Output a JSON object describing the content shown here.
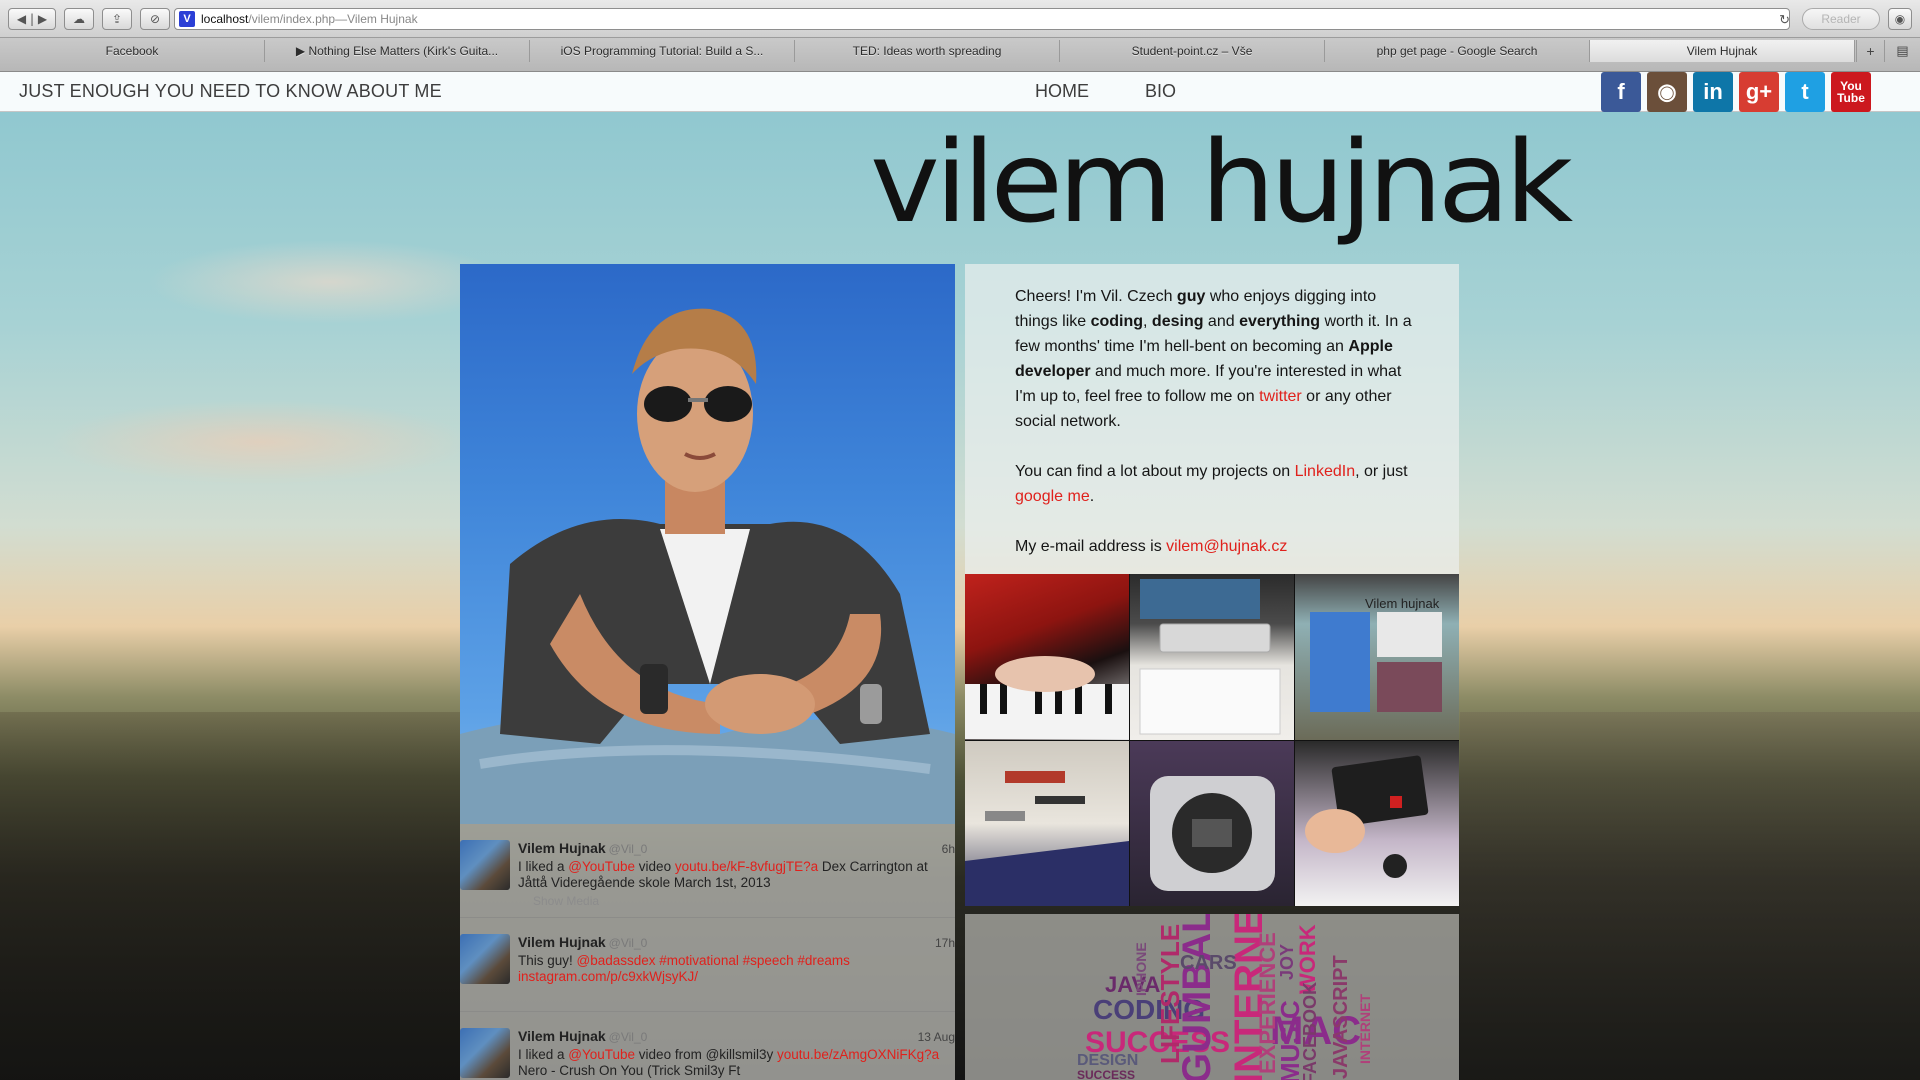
{
  "browser": {
    "url_host": "localhost",
    "url_path": "/vilem/index.php",
    "url_separator": " — ",
    "page_title": "Vilem Hujnak",
    "reader_label": "Reader",
    "tabs": [
      {
        "label": "Facebook",
        "active": false
      },
      {
        "label": "▶ Nothing Else Matters (Kirk's Guita...",
        "active": false
      },
      {
        "label": "iOS Programming Tutorial: Build a S...",
        "active": false
      },
      {
        "label": "TED: Ideas worth spreading",
        "active": false
      },
      {
        "label": "Student-point.cz – Vše",
        "active": false
      },
      {
        "label": "php get page - Google Search",
        "active": false
      },
      {
        "label": "Vilem Hujnak",
        "active": true
      }
    ]
  },
  "header": {
    "tagline": "JUST ENOUGH YOU NEED TO KNOW ABOUT ME",
    "nav": [
      {
        "label": "HOME"
      },
      {
        "label": "BIO"
      }
    ],
    "socials": [
      {
        "name": "facebook",
        "glyph": "f",
        "color": "#3b5998"
      },
      {
        "name": "instagram",
        "glyph": "◉",
        "color": "#6b4f3a"
      },
      {
        "name": "linkedin",
        "glyph": "in",
        "color": "#0e76a8"
      },
      {
        "name": "googleplus",
        "glyph": "g+",
        "color": "#d73d32"
      },
      {
        "name": "twitter",
        "glyph": "t",
        "color": "#1fa0e3"
      },
      {
        "name": "youtube",
        "glyph": "You Tube",
        "color": "#cc181e"
      }
    ]
  },
  "hero": {
    "name_first": "vilem",
    "name_last": "hujnak"
  },
  "bio": {
    "p1": {
      "t1": "Cheers! I'm Vil. Czech ",
      "b1": "guy",
      "t2": " who enjoys digging into things like ",
      "b2": "coding",
      "t3": ", ",
      "b3": "desing",
      "t4": " and ",
      "b4": "everything",
      "t5": " worth it. In a few months' time I'm hell-bent on becoming an ",
      "b5": "Apple developer",
      "t6": " and much more. If you're interested in what I'm up to, feel free to follow me on ",
      "link": "twitter",
      "t7": " or any other social network."
    },
    "p2": {
      "t1": "You can find a lot about my projects on ",
      "link1": "LinkedIn",
      "t2": ", or just ",
      "link2": "google me",
      "t3": "."
    },
    "p3": {
      "t1": "My e-mail address is ",
      "email": "vilem@hujnak.cz"
    }
  },
  "instagram": {
    "photos": [
      {
        "subject": "piano"
      },
      {
        "subject": "desk"
      },
      {
        "subject": "website"
      },
      {
        "subject": "tools"
      },
      {
        "subject": "mac-mini"
      },
      {
        "subject": "ssd"
      }
    ],
    "website_thumb_label": "Vilem hujnak"
  },
  "tweets": [
    {
      "name": "Vilem Hujnak",
      "handle": "@Vil_0",
      "time": "6h",
      "parts": {
        "t1": "I liked a ",
        "m1": "@YouTube",
        "t2": " video ",
        "l1": "youtu.be/kF-8vfugjTE?a",
        "t3": " Dex Carrington at Jåttå Videregående skole March 1st, 2013"
      },
      "media": "Show Media"
    },
    {
      "name": "Vilem Hujnak",
      "handle": "@Vil_0",
      "time": "17h",
      "parts": {
        "t1": "This guy! ",
        "m1": "@badassdex #motivational #speech #dreams",
        "t2": " ",
        "l1": "instagram.com/p/c9xkWjsyKJ/",
        "t3": ""
      },
      "media": ""
    },
    {
      "name": "Vilem Hujnak",
      "handle": "@Vil_0",
      "time": "13 Aug",
      "parts": {
        "t1": "I liked a ",
        "m1": "@YouTube",
        "t2": " video from @killsmil3y ",
        "l1": "youtu.be/zAmgOXNiFKg?a",
        "t3": " Nero - Crush On You (Trick Smil3y Ft"
      },
      "media": ""
    }
  ],
  "wordcloud": {
    "words": [
      {
        "text": "CODING",
        "color": "#4a3f78"
      },
      {
        "text": "SUCCESS",
        "color": "#c8287a"
      },
      {
        "text": "GUMBALL",
        "color": "#8b2c8b"
      },
      {
        "text": "INTERNET",
        "color": "#c8287a"
      },
      {
        "text": "MAC",
        "color": "#8b2c8b"
      },
      {
        "text": "JAVA",
        "color": "#6a2a6a"
      },
      {
        "text": "DESIGN",
        "color": "#5a5a7a"
      },
      {
        "text": "LIFESTYLE",
        "color": "#b02a6a"
      },
      {
        "text": "CARS",
        "color": "#5a4a6a"
      },
      {
        "text": "EXPERIENCE",
        "color": "#b0407a"
      },
      {
        "text": "JOY",
        "color": "#7a3a7a"
      },
      {
        "text": "WORK",
        "color": "#c8287a"
      },
      {
        "text": "MUSIC",
        "color": "#8b2c8b"
      },
      {
        "text": "FACEBOOK",
        "color": "#7a3a6a"
      },
      {
        "text": "JAVASCRIPT",
        "color": "#8a3a6a"
      },
      {
        "text": "IPHONE",
        "color": "#7a4a7a"
      },
      {
        "text": "SUCCESS",
        "color": "#6a2a5a"
      },
      {
        "text": "INTERNET",
        "color": "#b0407a"
      }
    ]
  }
}
